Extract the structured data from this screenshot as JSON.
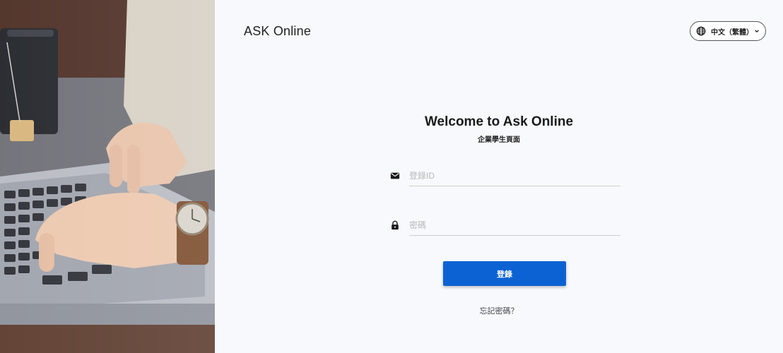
{
  "header": {
    "brand": "ASK Online",
    "language": {
      "label": "中文（繁體）",
      "icon": "globe-icon",
      "caret": "chevron-down-icon"
    }
  },
  "login": {
    "title": "Welcome to Ask Online",
    "subtitle": "企業學生頁面",
    "id_field": {
      "icon": "mail-icon",
      "placeholder": "登錄ID",
      "value": ""
    },
    "password_field": {
      "icon": "lock-icon",
      "placeholder": "密碼",
      "value": ""
    },
    "submit_label": "登錄",
    "forgot_label": "忘記密碼？"
  },
  "colors": {
    "primary": "#0c62d3",
    "background": "#f8f9fd",
    "text": "#1a1a1a"
  }
}
